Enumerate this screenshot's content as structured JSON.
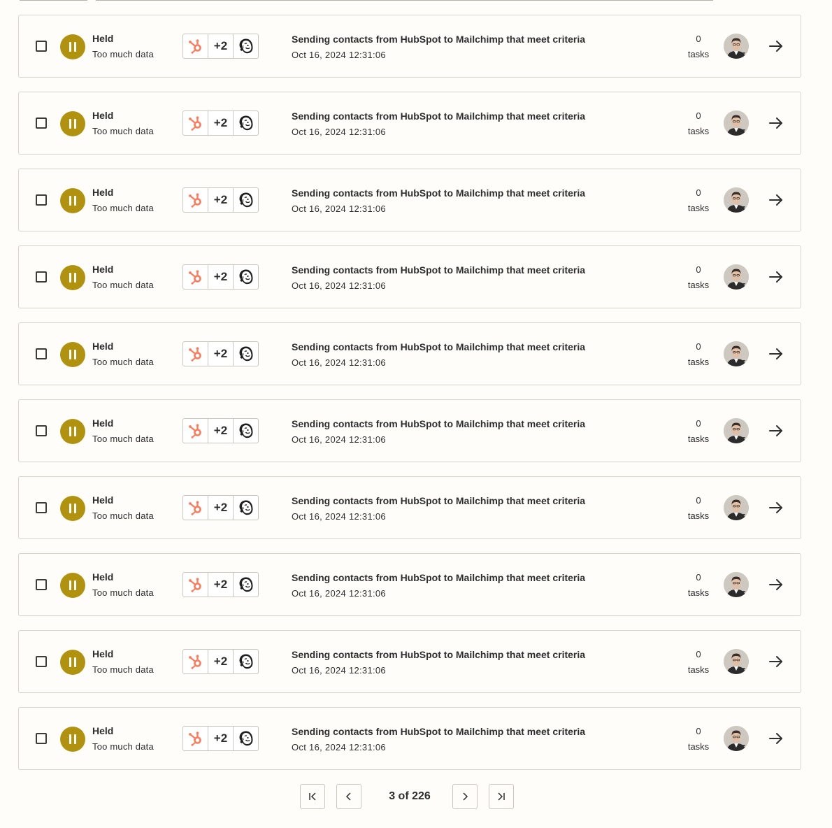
{
  "runs": [
    {
      "status": "Held",
      "reason": "Too much data",
      "extra_apps": "+2",
      "apps": [
        "hubspot-icon",
        "mailchimp-icon"
      ],
      "zap_name": "Sending contacts from HubSpot to Mailchimp that meet criteria",
      "date": "Oct 16, 2024 12:31:06",
      "task_count": "0",
      "task_label": "tasks"
    },
    {
      "status": "Held",
      "reason": "Too much data",
      "extra_apps": "+2",
      "apps": [
        "hubspot-icon",
        "mailchimp-icon"
      ],
      "zap_name": "Sending contacts from HubSpot to Mailchimp that meet criteria",
      "date": "Oct 16, 2024 12:31:06",
      "task_count": "0",
      "task_label": "tasks"
    },
    {
      "status": "Held",
      "reason": "Too much data",
      "extra_apps": "+2",
      "apps": [
        "hubspot-icon",
        "mailchimp-icon"
      ],
      "zap_name": "Sending contacts from HubSpot to Mailchimp that meet criteria",
      "date": "Oct 16, 2024 12:31:06",
      "task_count": "0",
      "task_label": "tasks"
    },
    {
      "status": "Held",
      "reason": "Too much data",
      "extra_apps": "+2",
      "apps": [
        "hubspot-icon",
        "mailchimp-icon"
      ],
      "zap_name": "Sending contacts from HubSpot to Mailchimp that meet criteria",
      "date": "Oct 16, 2024 12:31:06",
      "task_count": "0",
      "task_label": "tasks"
    },
    {
      "status": "Held",
      "reason": "Too much data",
      "extra_apps": "+2",
      "apps": [
        "hubspot-icon",
        "mailchimp-icon"
      ],
      "zap_name": "Sending contacts from HubSpot to Mailchimp that meet criteria",
      "date": "Oct 16, 2024 12:31:06",
      "task_count": "0",
      "task_label": "tasks"
    },
    {
      "status": "Held",
      "reason": "Too much data",
      "extra_apps": "+2",
      "apps": [
        "hubspot-icon",
        "mailchimp-icon"
      ],
      "zap_name": "Sending contacts from HubSpot to Mailchimp that meet criteria",
      "date": "Oct 16, 2024 12:31:06",
      "task_count": "0",
      "task_label": "tasks"
    },
    {
      "status": "Held",
      "reason": "Too much data",
      "extra_apps": "+2",
      "apps": [
        "hubspot-icon",
        "mailchimp-icon"
      ],
      "zap_name": "Sending contacts from HubSpot to Mailchimp that meet criteria",
      "date": "Oct 16, 2024 12:31:06",
      "task_count": "0",
      "task_label": "tasks"
    },
    {
      "status": "Held",
      "reason": "Too much data",
      "extra_apps": "+2",
      "apps": [
        "hubspot-icon",
        "mailchimp-icon"
      ],
      "zap_name": "Sending contacts from HubSpot to Mailchimp that meet criteria",
      "date": "Oct 16, 2024 12:31:06",
      "task_count": "0",
      "task_label": "tasks"
    },
    {
      "status": "Held",
      "reason": "Too much data",
      "extra_apps": "+2",
      "apps": [
        "hubspot-icon",
        "mailchimp-icon"
      ],
      "zap_name": "Sending contacts from HubSpot to Mailchimp that meet criteria",
      "date": "Oct 16, 2024 12:31:06",
      "task_count": "0",
      "task_label": "tasks"
    },
    {
      "status": "Held",
      "reason": "Too much data",
      "extra_apps": "+2",
      "apps": [
        "hubspot-icon",
        "mailchimp-icon"
      ],
      "zap_name": "Sending contacts from HubSpot to Mailchimp that meet criteria",
      "date": "Oct 16, 2024 12:31:06",
      "task_count": "0",
      "task_label": "tasks"
    }
  ],
  "pagination": {
    "current": "3",
    "total": "226",
    "label": "3 of 226"
  },
  "colors": {
    "held_status": "#b1920f",
    "hubspot": "#ff7a59",
    "background": "#fffdf9",
    "border": "#d7d4cc",
    "text": "#2d2e2e"
  },
  "icons": {
    "status": "pause-icon",
    "row_action": "arrow-right-icon",
    "first_page": "first-page-icon",
    "prev_page": "chevron-left-icon",
    "next_page": "chevron-right-icon",
    "last_page": "last-page-icon"
  }
}
